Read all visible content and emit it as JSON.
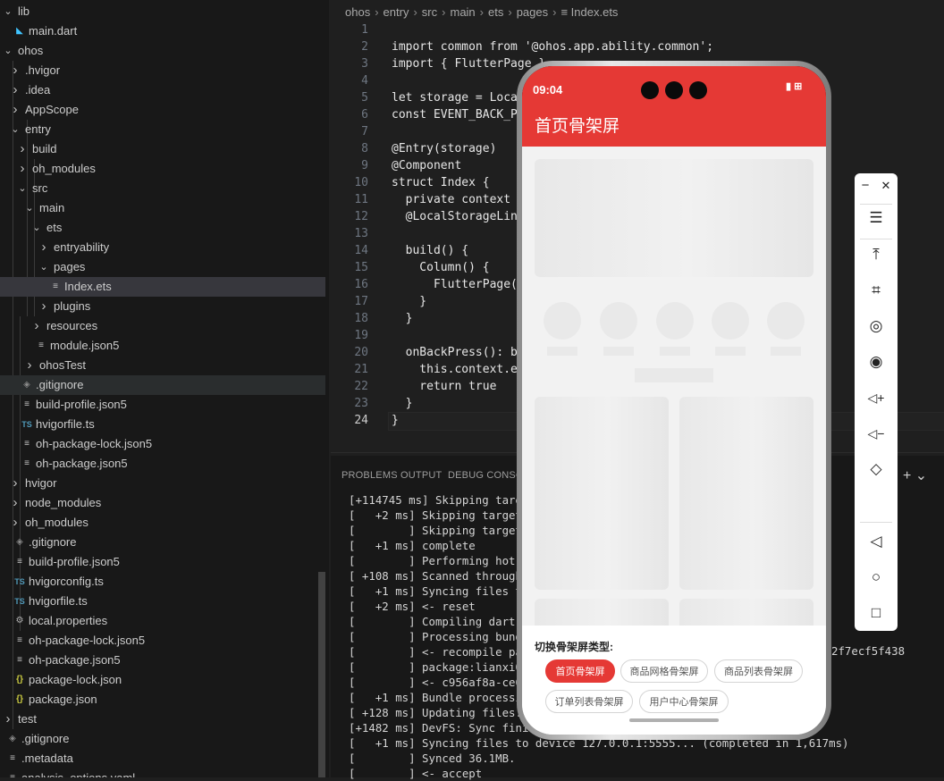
{
  "explorer": {
    "items": [
      {
        "label": "lib",
        "indent": 0,
        "chev": "v",
        "icon": ""
      },
      {
        "label": "main.dart",
        "indent": 1,
        "chev": "",
        "icon": "dart"
      },
      {
        "label": "ohos",
        "indent": 0,
        "chev": "v",
        "icon": ""
      },
      {
        "label": ".hvigor",
        "indent": 1,
        "chev": ">",
        "icon": ""
      },
      {
        "label": ".idea",
        "indent": 1,
        "chev": ">",
        "icon": ""
      },
      {
        "label": "AppScope",
        "indent": 1,
        "chev": ">",
        "icon": ""
      },
      {
        "label": "entry",
        "indent": 1,
        "chev": "v",
        "icon": ""
      },
      {
        "label": "build",
        "indent": 2,
        "chev": ">",
        "icon": ""
      },
      {
        "label": "oh_modules",
        "indent": 2,
        "chev": ">",
        "icon": ""
      },
      {
        "label": "src",
        "indent": 2,
        "chev": "v",
        "icon": ""
      },
      {
        "label": "main",
        "indent": 3,
        "chev": "v",
        "icon": ""
      },
      {
        "label": "ets",
        "indent": 4,
        "chev": "v",
        "icon": ""
      },
      {
        "label": "entryability",
        "indent": 5,
        "chev": ">",
        "icon": ""
      },
      {
        "label": "pages",
        "indent": 5,
        "chev": "v",
        "icon": ""
      },
      {
        "label": "Index.ets",
        "indent": 6,
        "chev": "",
        "icon": "lines",
        "state": "selected"
      },
      {
        "label": "plugins",
        "indent": 5,
        "chev": ">",
        "icon": ""
      },
      {
        "label": "resources",
        "indent": 4,
        "chev": ">",
        "icon": ""
      },
      {
        "label": "module.json5",
        "indent": 4,
        "chev": "",
        "icon": "lines"
      },
      {
        "label": "ohosTest",
        "indent": 3,
        "chev": ">",
        "icon": ""
      },
      {
        "label": ".gitignore",
        "indent": 2,
        "chev": "",
        "icon": "git",
        "state": "hover"
      },
      {
        "label": "build-profile.json5",
        "indent": 2,
        "chev": "",
        "icon": "lines"
      },
      {
        "label": "hvigorfile.ts",
        "indent": 2,
        "chev": "",
        "icon": "ts"
      },
      {
        "label": "oh-package-lock.json5",
        "indent": 2,
        "chev": "",
        "icon": "lines"
      },
      {
        "label": "oh-package.json5",
        "indent": 2,
        "chev": "",
        "icon": "lines"
      },
      {
        "label": "hvigor",
        "indent": 1,
        "chev": ">",
        "icon": ""
      },
      {
        "label": "node_modules",
        "indent": 1,
        "chev": ">",
        "icon": ""
      },
      {
        "label": "oh_modules",
        "indent": 1,
        "chev": ">",
        "icon": ""
      },
      {
        "label": ".gitignore",
        "indent": 1,
        "chev": "",
        "icon": "git"
      },
      {
        "label": "build-profile.json5",
        "indent": 1,
        "chev": "",
        "icon": "lines"
      },
      {
        "label": "hvigorconfig.ts",
        "indent": 1,
        "chev": "",
        "icon": "ts"
      },
      {
        "label": "hvigorfile.ts",
        "indent": 1,
        "chev": "",
        "icon": "ts"
      },
      {
        "label": "local.properties",
        "indent": 1,
        "chev": "",
        "icon": "gear"
      },
      {
        "label": "oh-package-lock.json5",
        "indent": 1,
        "chev": "",
        "icon": "lines"
      },
      {
        "label": "oh-package.json5",
        "indent": 1,
        "chev": "",
        "icon": "lines"
      },
      {
        "label": "package-lock.json",
        "indent": 1,
        "chev": "",
        "icon": "json"
      },
      {
        "label": "package.json",
        "indent": 1,
        "chev": "",
        "icon": "json"
      },
      {
        "label": "test",
        "indent": 0,
        "chev": ">",
        "icon": ""
      },
      {
        "label": ".gitignore",
        "indent": 0,
        "chev": "",
        "icon": "git"
      },
      {
        "label": ".metadata",
        "indent": 0,
        "chev": "",
        "icon": "lines"
      },
      {
        "label": "analysis_options.yaml",
        "indent": 0,
        "chev": "",
        "icon": "lines"
      }
    ]
  },
  "icons": {
    "dart": "◣",
    "lines": "≡",
    "ts": "TS",
    "json": "{}",
    "git": "◈",
    "gear": "⚙",
    "chev_open": "⌄",
    "chev_closed": "›"
  },
  "breadcrumb": [
    "ohos",
    "entry",
    "src",
    "main",
    "ets",
    "pages",
    "Index.ets"
  ],
  "editor": {
    "current_line": 24,
    "lines": [
      {
        "n": "1",
        "t": ""
      },
      {
        "n": "2",
        "t": "import common from '@ohos.app.ability.common';"
      },
      {
        "n": "3",
        "t": "import { FlutterPage }"
      },
      {
        "n": "4",
        "t": ""
      },
      {
        "n": "5",
        "t": "let storage = Local"
      },
      {
        "n": "6",
        "t": "const EVENT_BACK_PR"
      },
      {
        "n": "7",
        "t": ""
      },
      {
        "n": "8",
        "t": "@Entry(storage)"
      },
      {
        "n": "9",
        "t": "@Component"
      },
      {
        "n": "10",
        "t": "struct Index {"
      },
      {
        "n": "11",
        "t": "  private context :"
      },
      {
        "n": "12",
        "t": "  @LocalStorageLin"
      },
      {
        "n": "13",
        "t": ""
      },
      {
        "n": "14",
        "t": "  build() {"
      },
      {
        "n": "15",
        "t": "    Column() {"
      },
      {
        "n": "16",
        "t": "      FlutterPage("
      },
      {
        "n": "17",
        "t": "    }"
      },
      {
        "n": "18",
        "t": "  }"
      },
      {
        "n": "19",
        "t": ""
      },
      {
        "n": "20",
        "t": "  onBackPress(): bo"
      },
      {
        "n": "21",
        "t": "    this.context.ev"
      },
      {
        "n": "22",
        "t": "    return true"
      },
      {
        "n": "23",
        "t": "  }"
      },
      {
        "n": "24",
        "t": "}"
      }
    ]
  },
  "panel": {
    "tabs": [
      "PROBLEMS",
      "OUTPUT",
      "DEBUG CONSOL"
    ],
    "actions": "+ ⌄",
    "log": [
      "[+114745 ms] Skipping targe",
      "[   +2 ms] Skipping target:",
      "[        ] Skipping target:",
      "[   +1 ms] complete",
      "[        ] Performing hot r",
      "[ +108 ms] Scanned through",
      "[   +1 ms] Syncing files to",
      "[   +2 ms] <- reset",
      "[        ] Compiling dart t",
      "[        ] Processing bundl",
      "[        ] <- recompile pac",
      "[        ] package:lianxi00",
      "[        ] <- c956af8a-ce68",
      "[   +1 ms] Bundle processin",
      "[ +128 ms] Updating files.",
      "[+1482 ms] DevFS: Sync finis",
      "[   +1 ms] Syncing files to device 127.0.0.1:5555... (completed in 1,617ms)",
      "[        ] Synced 36.1MB.",
      "[        ] <- accept"
    ],
    "hash_tail": "2f7ecf5f438"
  },
  "phone": {
    "status_time": "09:04",
    "status_right": "▮ ⊞",
    "app_title": "首页骨架屏",
    "sheet_title": "切换骨架屏类型:",
    "chips": [
      {
        "label": "首页骨架屏",
        "active": true
      },
      {
        "label": "商品网格骨架屏",
        "active": false
      },
      {
        "label": "商品列表骨架屏",
        "active": false
      },
      {
        "label": "订单列表骨架屏",
        "active": false
      },
      {
        "label": "用户中心骨架屏",
        "active": false
      }
    ]
  },
  "toolbar": {
    "minimize": "−",
    "close": "✕",
    "menu": "☰",
    "pin_top": "⤒",
    "crop": "⌗",
    "rotate": "◎",
    "screenshot": "◉",
    "volume_up": "◁+",
    "volume_down": "◁−",
    "shake": "◇",
    "back": "◁",
    "home": "○",
    "recent": "□"
  }
}
